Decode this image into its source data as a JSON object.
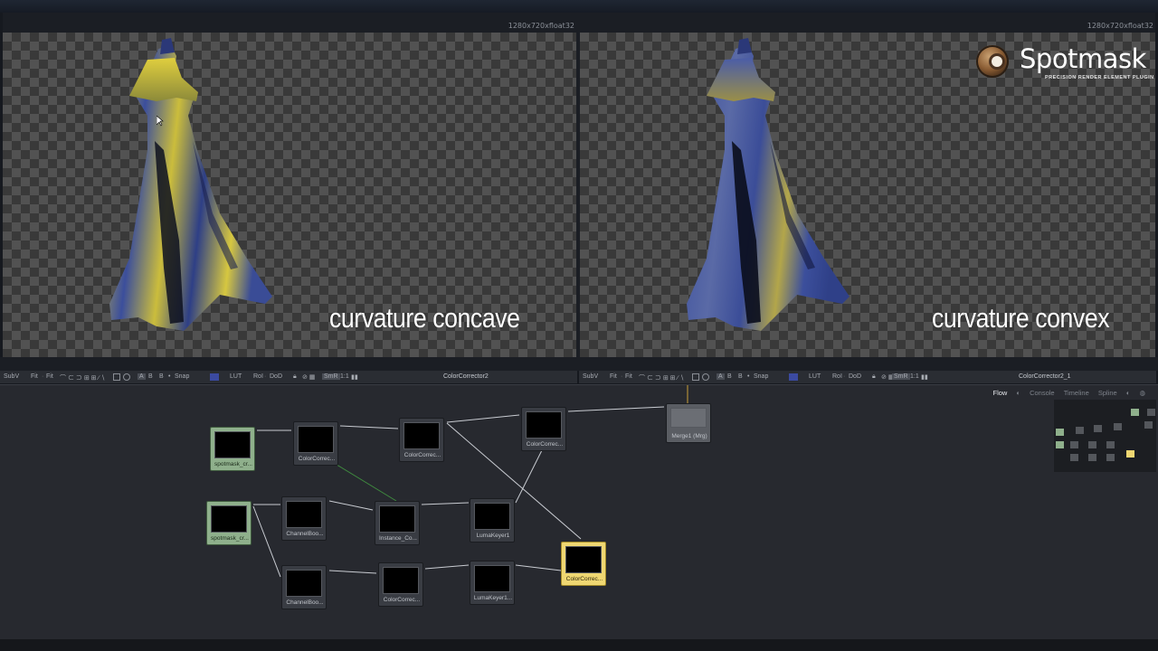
{
  "viewers": [
    {
      "resolution": "1280x720xfloat32",
      "caption": "curvature concave",
      "toolbar": {
        "subv": "SubV",
        "fit1": "Fit",
        "fit2": "Fit",
        "snap": "Snap",
        "lut": "LUT",
        "roi": "RoI",
        "dod": "DoD",
        "smr": "SmR",
        "ratio": "1:1",
        "node_title": "ColorCorrector2"
      }
    },
    {
      "resolution": "1280x720xfloat32",
      "caption": "curvature convex",
      "toolbar": {
        "subv": "SubV",
        "fit1": "Fit",
        "fit2": "Fit",
        "snap": "Snap",
        "lut": "LUT",
        "roi": "RoI",
        "dod": "DoD",
        "smr": "SmR",
        "ratio": "1:1",
        "node_title": "ColorCorrector2_1"
      }
    }
  ],
  "logo": {
    "name_part1": "Spot",
    "name_part2": "mask",
    "tagline": "PRECISION RENDER ELEMENT PLUGIN"
  },
  "flow": {
    "tabs": [
      "Flow",
      "Console",
      "Timeline",
      "Spline"
    ],
    "active_tab": "Flow",
    "nodes": [
      {
        "label": "spotmask_cr...",
        "kind": "loader"
      },
      {
        "label": "ColorCorrec...",
        "kind": "tool"
      },
      {
        "label": "ColorCorrec...",
        "kind": "tool"
      },
      {
        "label": "ColorCorrec...",
        "kind": "tool"
      },
      {
        "label": "Merge1  (Mrg)",
        "kind": "merge"
      },
      {
        "label": "spotmask_cr...",
        "kind": "loader"
      },
      {
        "label": "ChannelBoo...",
        "kind": "tool"
      },
      {
        "label": "Instance_Co...",
        "kind": "tool"
      },
      {
        "label": "LumaKeyer1",
        "kind": "tool"
      },
      {
        "label": "ChannelBoo...",
        "kind": "tool"
      },
      {
        "label": "ColorCorrec...",
        "kind": "tool"
      },
      {
        "label": "LumaKeyer1...",
        "kind": "tool"
      },
      {
        "label": "ColorCorrec...",
        "kind": "active"
      }
    ]
  },
  "colors": {
    "loader_node": "#8fb08c",
    "active_node": "#efd772",
    "gown_yellow": "#d8c73a",
    "gown_blue": "#3b4e9c"
  }
}
